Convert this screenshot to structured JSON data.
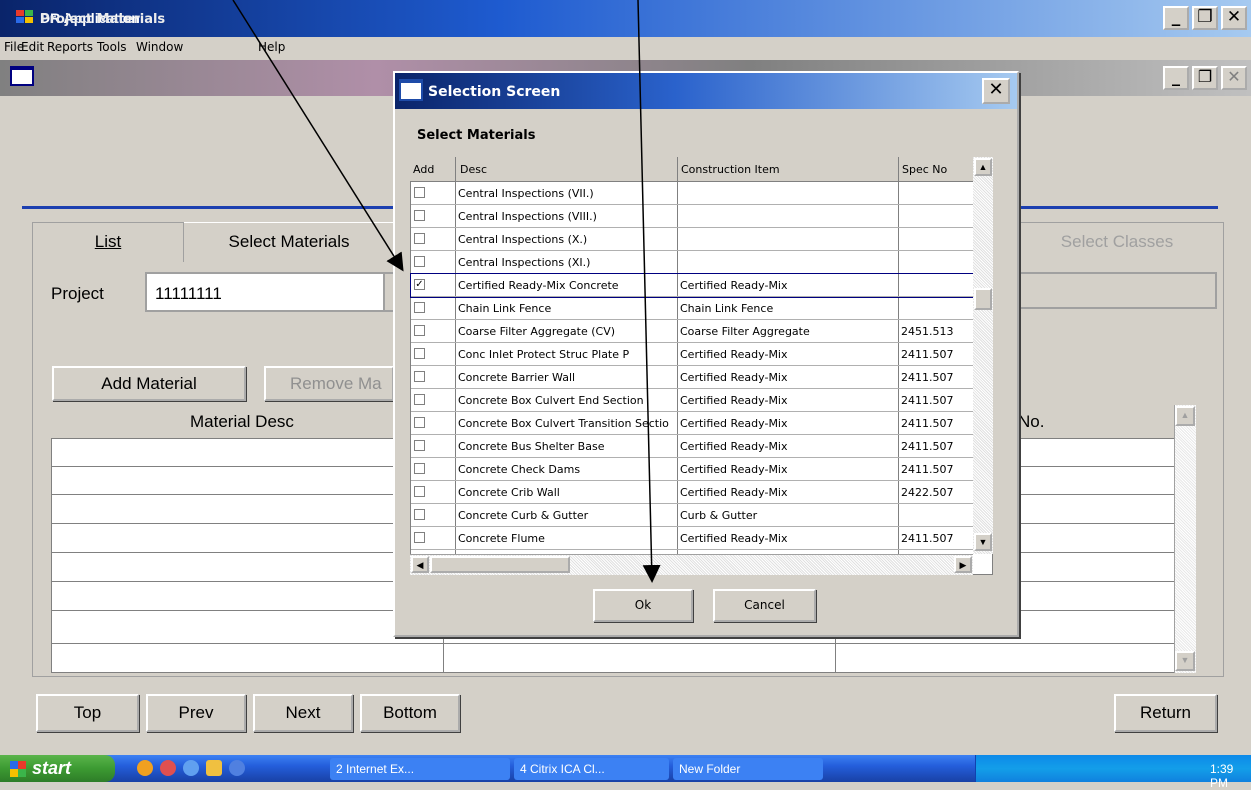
{
  "app": {
    "title": "DR Application"
  },
  "menu": [
    "File",
    "Edit",
    "Reports",
    "Tools",
    "Window",
    "Help"
  ],
  "child": {
    "title": "Project Materials"
  },
  "tabs": {
    "list": "List",
    "select_materials": "Select Materials",
    "select_classes": "Select Classes"
  },
  "project": {
    "label": "Project",
    "value": "11111111"
  },
  "buttons": {
    "add_material": "Add Material",
    "remove_material": "Remove Ma",
    "top": "Top",
    "prev": "Prev",
    "next": "Next",
    "bottom": "Bottom",
    "return": "Return"
  },
  "grid": {
    "col1": "Material Desc",
    "col3": "No."
  },
  "dialog": {
    "title": "Selection Screen",
    "section_label": "Select Materials",
    "columns": [
      "Add",
      "Desc",
      "Construction Item",
      "Spec No"
    ],
    "rows": [
      {
        "checked": false,
        "desc": "Central Inspections (VII.)",
        "item": "",
        "spec": ""
      },
      {
        "checked": false,
        "desc": "Central Inspections (VIII.)",
        "item": "",
        "spec": ""
      },
      {
        "checked": false,
        "desc": "Central Inspections (X.)",
        "item": "",
        "spec": ""
      },
      {
        "checked": false,
        "desc": "Central Inspections (XI.)",
        "item": "",
        "spec": ""
      },
      {
        "checked": true,
        "desc": "Certified Ready-Mix Concrete",
        "item": "Certified Ready-Mix",
        "spec": ""
      },
      {
        "checked": false,
        "desc": "Chain Link Fence",
        "item": "Chain Link Fence",
        "spec": ""
      },
      {
        "checked": false,
        "desc": "Coarse Filter Aggregate (CV)",
        "item": "Coarse Filter Aggregate",
        "spec": "2451.513"
      },
      {
        "checked": false,
        "desc": "Conc Inlet Protect Struc Plate P",
        "item": "Certified Ready-Mix",
        "spec": "2411.507"
      },
      {
        "checked": false,
        "desc": "Concrete Barrier Wall",
        "item": "Certified Ready-Mix",
        "spec": "2411.507"
      },
      {
        "checked": false,
        "desc": "Concrete Box Culvert End Section",
        "item": "Certified Ready-Mix",
        "spec": "2411.507"
      },
      {
        "checked": false,
        "desc": "Concrete Box Culvert Transition Sectio",
        "item": "Certified Ready-Mix",
        "spec": "2411.507"
      },
      {
        "checked": false,
        "desc": "Concrete Bus Shelter Base",
        "item": "Certified Ready-Mix",
        "spec": "2411.507"
      },
      {
        "checked": false,
        "desc": "Concrete Check Dams",
        "item": "Certified Ready-Mix",
        "spec": "2411.507"
      },
      {
        "checked": false,
        "desc": "Concrete Crib Wall",
        "item": "Certified Ready-Mix",
        "spec": "2422.507"
      },
      {
        "checked": false,
        "desc": "Concrete Curb & Gutter",
        "item": "Curb & Gutter",
        "spec": ""
      },
      {
        "checked": false,
        "desc": "Concrete Flume",
        "item": "Certified Ready-Mix",
        "spec": "2411.507"
      }
    ],
    "ok": "Ok",
    "cancel": "Cancel"
  },
  "taskbar": {
    "start": "start",
    "tasks": [
      "2 Internet Ex...",
      "4 Citrix ICA Cl...",
      "New Folder"
    ],
    "clock": "1:39 PM"
  },
  "colors": {
    "title_blue": "#0a246a",
    "accent_line": "#1c3fb0",
    "taskbar": "#245edb",
    "start_green": "#3c9a32"
  }
}
